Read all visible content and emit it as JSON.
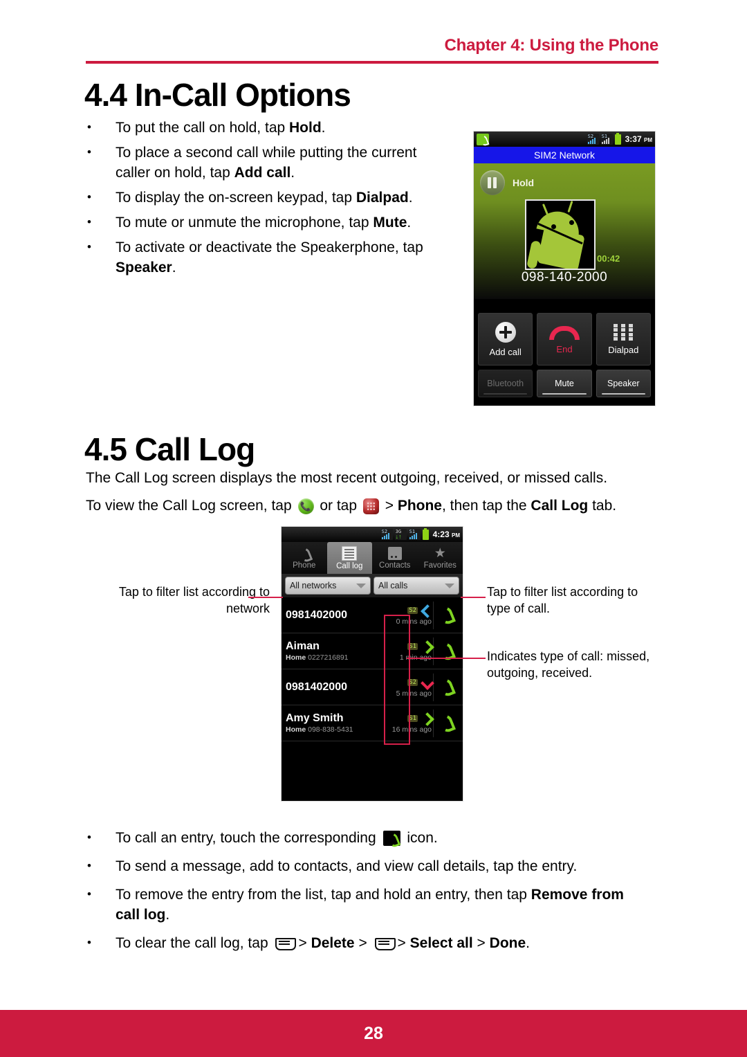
{
  "header": {
    "chapter": "Chapter 4: Using the Phone"
  },
  "footer": {
    "page_number": "28",
    "bar_color": "#cc1b3f"
  },
  "sections": {
    "in_call": {
      "heading": "4.4 In-Call Options",
      "bullets": [
        {
          "prefix": "To put the call on hold, tap ",
          "bold": "Hold",
          "suffix": "."
        },
        {
          "prefix": "To place a second call while putting the current caller on hold, tap ",
          "bold": "Add call",
          "suffix": "."
        },
        {
          "prefix": "To display the on-screen keypad, tap ",
          "bold": "Dialpad",
          "suffix": "."
        },
        {
          "prefix": "To mute or unmute the microphone, tap ",
          "bold": "Mute",
          "suffix": "."
        },
        {
          "prefix": "To activate or deactivate the Speakerphone, tap ",
          "bold": "Speaker",
          "suffix": "."
        }
      ]
    },
    "call_log": {
      "heading": "4.5 Call Log",
      "paragraph_1": "The Call Log screen displays the most recent outgoing, received, or missed calls.",
      "paragraph_2": {
        "part_1": "To view the Call Log screen, tap ",
        "part_2": " or tap ",
        "part_3": " > ",
        "bold_1": "Phone",
        "part_4": ", then tap the ",
        "bold_2": "Call Log",
        "part_5": " tab."
      },
      "bullets": [
        {
          "prefix": "To call an entry, touch the corresponding ",
          "icon": "call-entry-icon",
          "suffix": " icon."
        },
        {
          "prefix": "To send a message, add to contacts, and view call details, tap the entry.",
          "bold": "",
          "suffix": ""
        },
        {
          "prefix": "To remove the entry from the list, tap and hold an entry, then tap ",
          "bold": "Remove from call log",
          "suffix": "."
        },
        {
          "prefix": "To clear the call log, tap ",
          "bold_1": "Delete",
          "bold_2": "Select all",
          "bold_3": "Done",
          "suffix": "."
        }
      ]
    }
  },
  "phone_incall": {
    "status_bar": {
      "call_icon": "in-call-phone-icon",
      "sim1_label": "S2",
      "sim2_label": "S1",
      "battery": "battery-icon",
      "time": "3:37",
      "meridiem": "PM"
    },
    "sim_banner": "SIM2 Network",
    "hold_label": "Hold",
    "call_timer": "00:42",
    "call_number": "098-140-2000",
    "avatar": "android-robot-avatar",
    "buttons_primary": [
      {
        "label": "Add call",
        "icon": "add-call-icon"
      },
      {
        "label": "End",
        "icon": "end-call-icon"
      },
      {
        "label": "Dialpad",
        "icon": "dialpad-icon"
      }
    ],
    "buttons_secondary": [
      {
        "label": "Bluetooth",
        "state": "disabled"
      },
      {
        "label": "Mute",
        "state": "enabled"
      },
      {
        "label": "Speaker",
        "state": "enabled"
      }
    ]
  },
  "phone_calllog": {
    "status_bar": {
      "sim1_label": "S2",
      "data_label": "3G",
      "sim2_label": "S1",
      "battery": "battery-icon",
      "time": "4:23",
      "meridiem": "PM"
    },
    "tabs": [
      {
        "label": "Phone",
        "icon": "phone-tab-icon",
        "active": false
      },
      {
        "label": "Call log",
        "icon": "call-log-tab-icon",
        "active": true
      },
      {
        "label": "Contacts",
        "icon": "contacts-tab-icon",
        "active": false
      },
      {
        "label": "Favorites",
        "icon": "favorites-tab-icon",
        "active": false
      }
    ],
    "filters": [
      {
        "label": "All networks"
      },
      {
        "label": "All calls"
      }
    ],
    "entries": [
      {
        "name": "0981402000",
        "sub_label": "",
        "sub_number": "",
        "sim": "S2",
        "direction": "in",
        "time": "0 mins ago"
      },
      {
        "name": "Aiman",
        "sub_label": "Home",
        "sub_number": "0227216891",
        "sim": "S1",
        "direction": "out",
        "time": "1 min ago"
      },
      {
        "name": "0981402000",
        "sub_label": "",
        "sub_number": "",
        "sim": "S2",
        "direction": "missed",
        "time": "5 mins ago"
      },
      {
        "name": "Amy Smith",
        "sub_label": "Home",
        "sub_number": "098-838-5431",
        "sim": "S1",
        "direction": "out",
        "time": "16 mins ago"
      }
    ]
  },
  "annotations": {
    "left": "Tap to filter list according to network",
    "right_1": "Tap to filter list according to type of call.",
    "right_2": "Indicates type of call: missed, outgoing, received."
  }
}
